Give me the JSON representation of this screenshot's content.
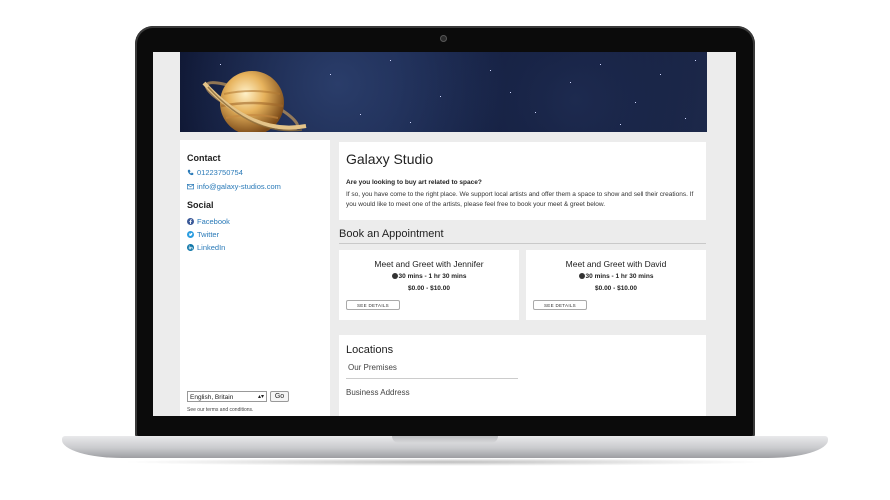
{
  "sidebar": {
    "contact_heading": "Contact",
    "phone": "01223750754",
    "email": "info@galaxy-studios.com",
    "social_heading": "Social",
    "social_links": [
      "Facebook",
      "Twitter",
      "LinkedIn"
    ],
    "language": "English, Britain",
    "go_label": "Go",
    "terms": "See our terms and conditions."
  },
  "intro": {
    "title": "Galaxy Studio",
    "question": "Are you looking to buy art related to space?",
    "body": "If so, you have come to the right place. We support local artists and offer them a space to show and sell their creations. If you would like to meet one of the artists, please feel free to book your meet & greet below."
  },
  "booking": {
    "heading": "Book an Appointment",
    "services": [
      {
        "name": "Meet and Greet with Jennifer",
        "duration": "30 mins - 1 hr 30 mins",
        "price": "$0.00 - $10.00",
        "button": "SEE DETAILS"
      },
      {
        "name": "Meet and Greet with David",
        "duration": "30 mins - 1 hr 30 mins",
        "price": "$0.00 - $10.00",
        "button": "SEE DETAILS"
      }
    ]
  },
  "locations": {
    "heading": "Locations",
    "premises": "Our Premises",
    "address_label": "Business Address"
  },
  "colors": {
    "link": "#2a7ab8",
    "page_bg": "#ececec"
  },
  "icons": [
    "planet-logo",
    "phone-icon",
    "mail-icon",
    "facebook-icon",
    "twitter-icon",
    "linkedin-icon",
    "clock-icon",
    "camera-icon"
  ]
}
